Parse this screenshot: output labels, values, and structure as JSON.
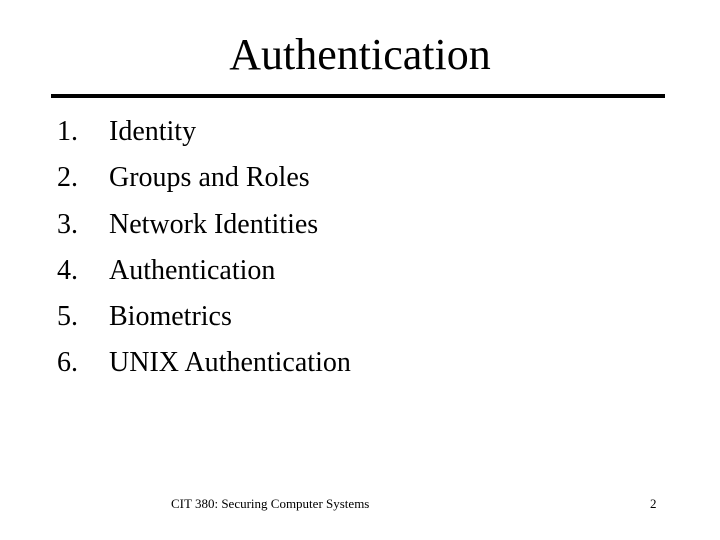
{
  "slide": {
    "title": "Authentication",
    "items": [
      {
        "number": "1.",
        "text": "Identity"
      },
      {
        "number": "2.",
        "text": "Groups and Roles"
      },
      {
        "number": "3.",
        "text": "Network Identities"
      },
      {
        "number": "4.",
        "text": "Authentication"
      },
      {
        "number": "5.",
        "text": "Biometrics"
      },
      {
        "number": "6.",
        "text": "UNIX Authentication"
      }
    ],
    "footer": "CIT 380: Securing Computer Systems",
    "page_number": "2"
  }
}
